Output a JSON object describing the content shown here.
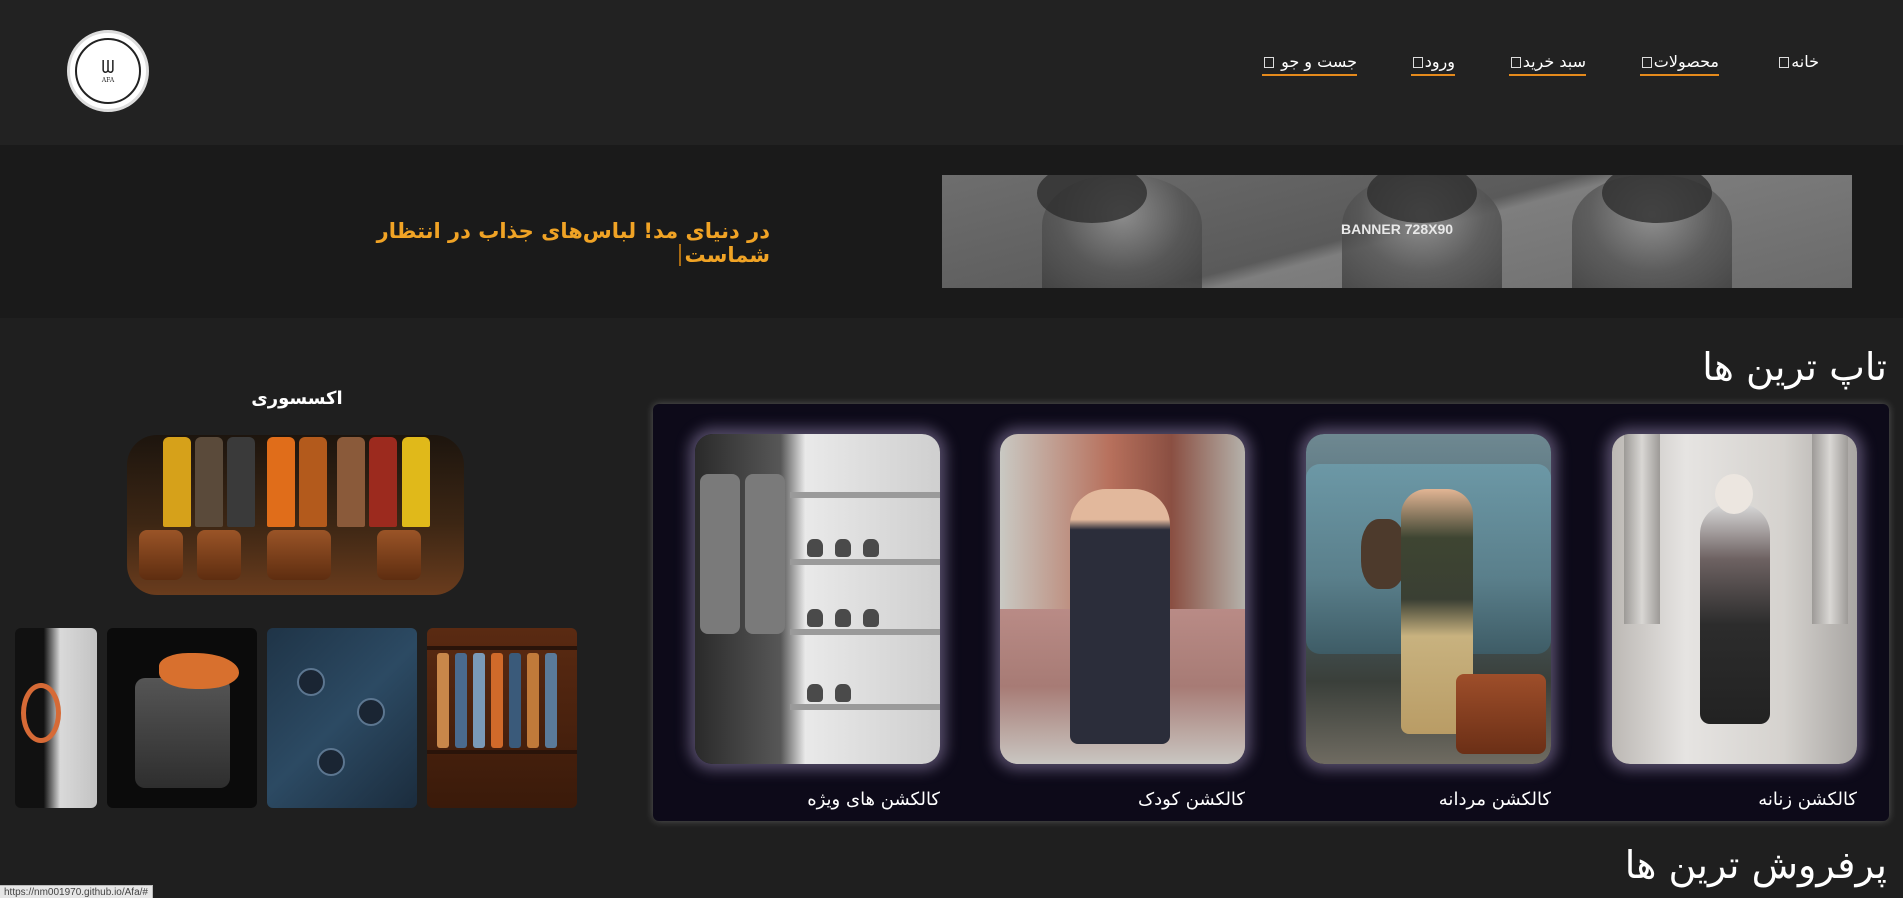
{
  "header": {
    "logo_text": "ᗯ",
    "logo_subtext": "AFA",
    "nav": [
      {
        "label": "خانه",
        "icon": "home-icon"
      },
      {
        "label": "محصولات",
        "icon": "grid-icon"
      },
      {
        "label": "سبد خرید",
        "icon": "cart-icon"
      },
      {
        "label": "ورود",
        "icon": "login-icon"
      },
      {
        "label": "جست و جو",
        "icon": "search-icon"
      }
    ]
  },
  "banner": {
    "ad_label": "BANNER 728X90",
    "tagline": "در دنیای مد! لباس‌های جذاب در انتظار شماست"
  },
  "top_section": {
    "title": "تاپ ترین ها",
    "cards": [
      {
        "label": "کالکشن زنانه"
      },
      {
        "label": "کالکشن مردانه"
      },
      {
        "label": "کالکشن کودک"
      },
      {
        "label": "کالکشن های ویژه"
      }
    ]
  },
  "accessories": {
    "title": "اکسسوری"
  },
  "bestsellers": {
    "title": "پرفروش ترین ها"
  },
  "status_url": "https://nm001970.github.io/Afa/#",
  "colors": {
    "accent": "#e58a1c",
    "tagline": "#f0a325",
    "panel": "#0d0a19",
    "background": "#1f1f1f"
  }
}
